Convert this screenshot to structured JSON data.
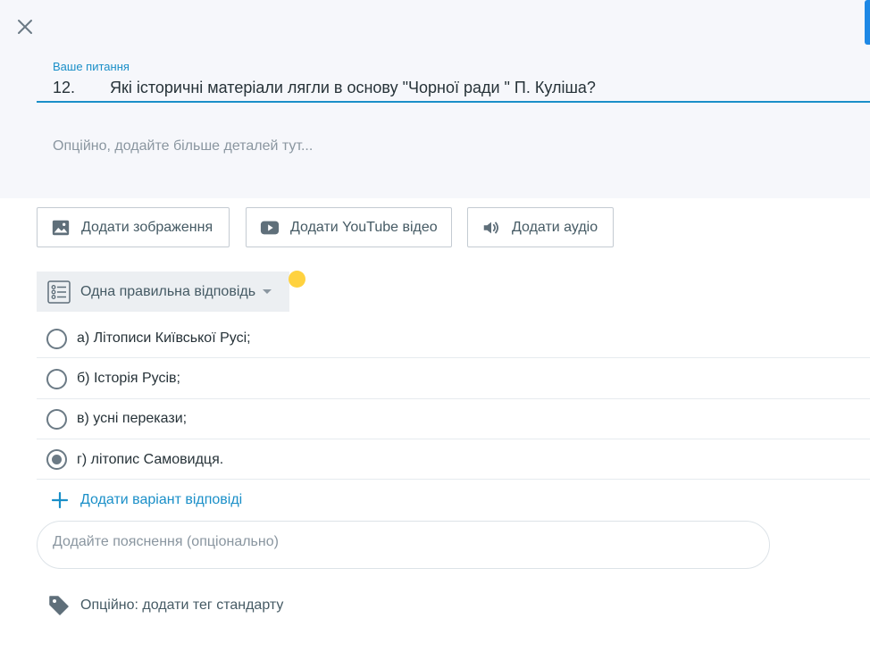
{
  "question": {
    "label": "Ваше питання",
    "number": "12.",
    "text": "Які історичні матеріали лягли в основу \"Чорної ради \" П. Куліша?",
    "details_placeholder": "Опційно, додайте більше деталей тут..."
  },
  "media_buttons": [
    {
      "label": "Додати зображення",
      "icon": "image-icon"
    },
    {
      "label": "Додати YouTube відео",
      "icon": "youtube-icon"
    },
    {
      "label": "Додати аудіо",
      "icon": "speaker-icon"
    }
  ],
  "answer_type": {
    "label": "Одна правильна відповідь",
    "icon": "list-icon"
  },
  "options": [
    {
      "text": "а) Літописи Київської Русі;",
      "selected": false
    },
    {
      "text": "б) Історія Русів;",
      "selected": false
    },
    {
      "text": "в) усні перекази;",
      "selected": false
    },
    {
      "text": "г) літопис Самовидця.",
      "selected": true
    }
  ],
  "add_option": {
    "label": "Додати варіант відповіді"
  },
  "explanation": {
    "placeholder": "Додайте пояснення (опціонально)"
  },
  "standard_tag": {
    "label": "Опційно: додати тег стандарту"
  },
  "colors": {
    "accent": "#1a8fc8",
    "panel_bg": "#f6f7fb",
    "highlight_dot": "#ffd23f"
  }
}
